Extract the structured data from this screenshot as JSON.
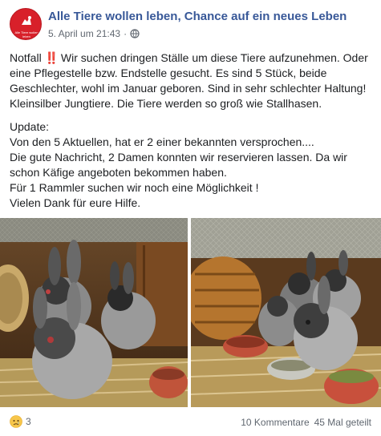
{
  "post": {
    "page_name": "Alle Tiere wollen leben, Chance auf ein neues Leben",
    "timestamp": "5. April um 21:43",
    "separator": "·",
    "avatar_small_text": "Alle Tiere wollen leben",
    "icons": {
      "privacy": "globe-icon",
      "avatar": "logo-mark",
      "reaction": "sad-face-icon"
    },
    "text": {
      "notfall_word": "Notfall",
      "notfall_emoji": "‼️",
      "notfall_rest": " Wir suchen dringen Ställe um diese Tiere aufzunehmen. Oder eine Pflegestelle bzw. Endstelle gesucht. Es sind 5 Stück, beide Geschlechter, wohl im Januar geboren. Sind in sehr schlechter Haltung! Kleinsilber Jungtiere. Die Tiere werden so groß wie Stallhasen.",
      "update_label": "Update:",
      "update_line1": "Von den 5 Aktuellen, hat er 2 einer bekannten versprochen....",
      "update_line2": "Die gute Nachricht, 2 Damen konnten wir reservieren lassen. Da wir schon Käfige angeboten bekommen haben.",
      "update_line3": "Für 1 Rammler suchen wir noch eine Möglichkeit !",
      "update_line4": "Vielen Dank für eure Hilfe."
    }
  },
  "footer": {
    "reaction_count": "3",
    "comments": "10 Kommentare",
    "shares": "45 Mal geteilt"
  },
  "colors": {
    "link": "#385898",
    "meta": "#606770",
    "avatar": "#d8202a"
  }
}
